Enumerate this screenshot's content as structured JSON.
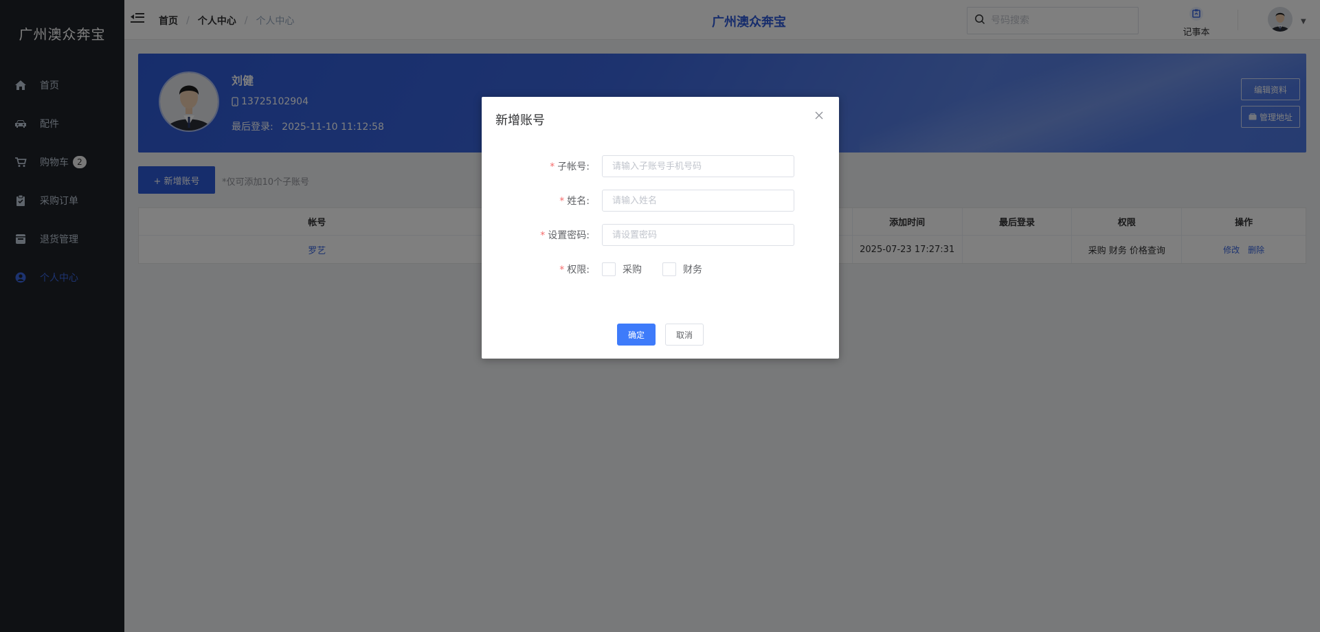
{
  "sidebar": {
    "brand": "广州澳众奔宝",
    "items": [
      {
        "label": "首页",
        "icon": "home-icon"
      },
      {
        "label": "配件",
        "icon": "car-icon"
      },
      {
        "label": "购物车",
        "icon": "cart-icon",
        "badge": "2"
      },
      {
        "label": "采购订单",
        "icon": "clipboard-icon"
      },
      {
        "label": "退货管理",
        "icon": "box-icon"
      },
      {
        "label": "个人中心",
        "icon": "user-icon",
        "active": true
      }
    ]
  },
  "header": {
    "breadcrumb": [
      "首页",
      "个人中心",
      "个人中心"
    ],
    "title": "广州澳众奔宝",
    "search_placeholder": "号码搜索",
    "notebook_label": "记事本"
  },
  "profile": {
    "name": "刘健",
    "phone": "13725102904",
    "last_login_label": "最后登录:",
    "last_login_value": "2025-11-10 11:12:58",
    "edit_button": "编辑资料",
    "address_button": "管理地址"
  },
  "accounts": {
    "add_button": "+ 新增账号",
    "tip": "*仅可添加10个子账号",
    "columns": {
      "account": "帐号",
      "added": "添加时间",
      "last_login": "最后登录",
      "permission": "权限",
      "ops": "操作"
    },
    "rows": [
      {
        "account": "罗艺",
        "added": "2025-07-23 17:27:31",
        "last_login": "",
        "permission": "采购 财务 价格查询",
        "edit": "修改",
        "delete": "删除"
      }
    ]
  },
  "modal": {
    "title": "新增账号",
    "fields": {
      "sub_account": {
        "label": "子帐号:",
        "placeholder": "请输入子账号手机号码"
      },
      "name": {
        "label": "姓名:",
        "placeholder": "请输入姓名"
      },
      "password": {
        "label": "设置密码:",
        "placeholder": "请设置密码"
      },
      "permission": {
        "label": "权限:",
        "options": [
          "采购",
          "财务"
        ]
      }
    },
    "required_mark": "*",
    "confirm": "确定",
    "cancel": "取消"
  },
  "colors": {
    "sidebar_bg": "#1f2229",
    "accent": "#2c5bd8",
    "primary_button": "#3e7bfa",
    "required": "#f56c6c"
  }
}
